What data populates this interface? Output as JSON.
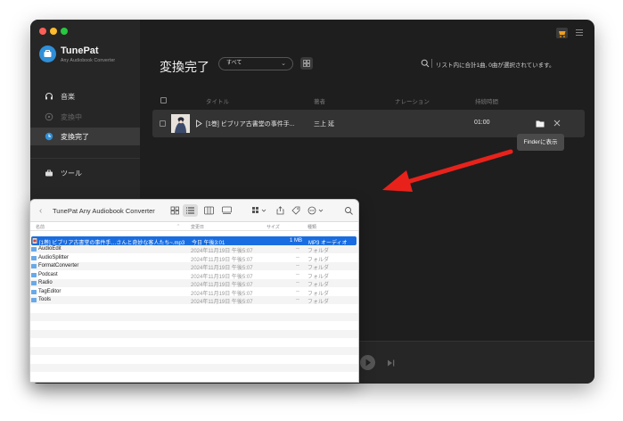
{
  "app": {
    "name": "TunePat",
    "subtitle": "Any Audiobook Converter",
    "traffic_colors": [
      "#ff5f57",
      "#febc2e",
      "#28c840"
    ],
    "accent": "#2f8fd8"
  },
  "sidebar": {
    "items": [
      {
        "label": "音楽",
        "icon": "headphones-icon"
      },
      {
        "label": "変換中",
        "icon": "converting-icon"
      },
      {
        "label": "変換完了",
        "icon": "clock-icon"
      },
      {
        "label": "ツール",
        "icon": "toolbox-icon"
      }
    ]
  },
  "main": {
    "title": "変換完了",
    "filter_value": "すべて",
    "status": "リスト内に合計1曲, 0曲が選択されています。",
    "columns": [
      "タイトル",
      "著者",
      "ナレーション",
      "持続時間"
    ],
    "row": {
      "title": "[1巻] ビブリア古書堂の事件手...",
      "author": "三上 延",
      "duration": "01:00"
    },
    "tooltip": "Finderに表示"
  },
  "finder": {
    "title": "TunePat Any Audiobook Converter",
    "columns": [
      "名前",
      "変更日",
      "サイズ",
      "種類"
    ],
    "rows": [
      {
        "name": "[1巻] ビブリア古書堂の事件手…さんと奇妙な客人たち~.mp3",
        "date": "今日 午後3:01",
        "size": "1 MB",
        "kind": "MP3 オーディオ",
        "selected": true,
        "icon": "audio-file-icon"
      },
      {
        "name": "AudioEdit",
        "date": "2024年11月19日 午後5:07",
        "size": "--",
        "kind": "フォルダ",
        "icon": "folder-icon"
      },
      {
        "name": "AudioSplitter",
        "date": "2024年11月19日 午後5:07",
        "size": "--",
        "kind": "フォルダ",
        "icon": "folder-icon"
      },
      {
        "name": "FormatConverter",
        "date": "2024年11月19日 午後5:07",
        "size": "--",
        "kind": "フォルダ",
        "icon": "folder-icon"
      },
      {
        "name": "Podcast",
        "date": "2024年11月19日 午後5:07",
        "size": "--",
        "kind": "フォルダ",
        "icon": "folder-icon"
      },
      {
        "name": "Radio",
        "date": "2024年11月19日 午後5:07",
        "size": "--",
        "kind": "フォルダ",
        "icon": "folder-icon"
      },
      {
        "name": "TagEditor",
        "date": "2024年11月19日 午後5:07",
        "size": "--",
        "kind": "フォルダ",
        "icon": "folder-icon"
      },
      {
        "name": "Tools",
        "date": "2024年11月19日 午後5:07",
        "size": "--",
        "kind": "フォルダ",
        "icon": "folder-icon"
      }
    ]
  },
  "annotation_color": "#e8221b"
}
